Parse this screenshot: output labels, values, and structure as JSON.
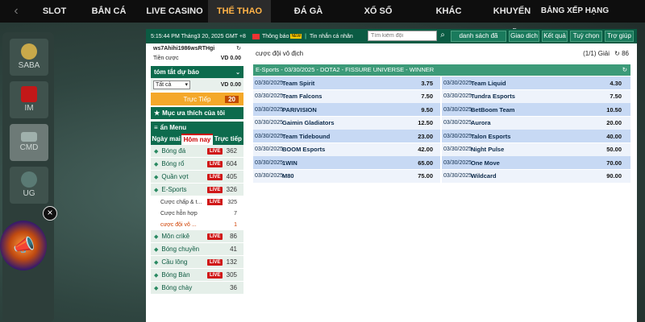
{
  "topnav": {
    "items": [
      "SLOT",
      "BẮN CÁ",
      "LIVE CASINO",
      "THỂ THAO",
      "ĐÁ GÀ",
      "XỔ SỐ",
      "KHÁC",
      "KHUYẾN MÃI",
      "BẢNG XẾP HẠNG"
    ],
    "active": 3
  },
  "providers": [
    "SABA",
    "IM",
    "CMD",
    "UG"
  ],
  "app": {
    "datetime": "5:15:44 PM Tháng3 20, 2025 GMT +8",
    "announcement": "Thông báo",
    "inbox": "Tin nhắn cá nhân",
    "inbox_badge": "NEW",
    "search_placeholder": "Tìm kiếm đội",
    "buttons": [
      "danh sách đã cược",
      "Giao dich",
      "Kết quả",
      "Tuỳ chọn",
      "Trợ giúp"
    ]
  },
  "sidebar": {
    "username": "ws7Ahihi1986wsRTHgi",
    "balance_label": "Tiền cược",
    "balance_value": "VD 0.00",
    "bet_summary": "tóm tắt dự báo",
    "bet_select": "Tất cả",
    "bet_amount": "VD 0.00",
    "live_label": "Trực Tiếp",
    "live_count": "20",
    "favorites": "Mục ưa thích của tôi",
    "menu": "ẩn Menu",
    "tabs": [
      "Ngày mai",
      "Hôm nay",
      "Trực tiếp"
    ],
    "sports": [
      {
        "name": "Bóng đá",
        "live": "LIVE",
        "count": "362"
      },
      {
        "name": "Bóng rổ",
        "live": "LIVE",
        "count": "604"
      },
      {
        "name": "Quần vợt",
        "live": "LIVE",
        "count": "405"
      },
      {
        "name": "E-Sports",
        "live": "LIVE",
        "count": "326"
      }
    ],
    "esports_sub": [
      {
        "name": "Cược chấp & t...",
        "live": "LIVE",
        "count": "325"
      },
      {
        "name": "Cược hỗn hợp",
        "live": "",
        "count": "7"
      },
      {
        "name": "cược đội vô ...",
        "live": "",
        "count": "1"
      }
    ],
    "sports2": [
      {
        "name": "Môn crikê",
        "live": "LIVE",
        "count": "86"
      },
      {
        "name": "Bóng chuyền",
        "live": "",
        "count": "41"
      },
      {
        "name": "Cầu lông",
        "live": "LIVE",
        "count": "132"
      },
      {
        "name": "Bóng Bàn",
        "live": "LIVE",
        "count": "305"
      },
      {
        "name": "Bóng chày",
        "live": "",
        "count": "36"
      }
    ]
  },
  "main": {
    "title": "cược đội vô địch",
    "pager": "(1/1) Giải",
    "refresh_count": "86",
    "league": "E-Sports - 03/30/2025 - DOTA2 - FISSURE UNIVERSE - WINNER",
    "rows": [
      [
        {
          "date": "03/30/2025",
          "team": "Team Spirit",
          "odds": "3.75"
        },
        {
          "date": "03/30/2025",
          "team": "Team Liquid",
          "odds": "4.30"
        }
      ],
      [
        {
          "date": "03/30/2025",
          "team": "Team Falcons",
          "odds": "7.50"
        },
        {
          "date": "03/30/2025",
          "team": "Tundra Esports",
          "odds": "7.50"
        }
      ],
      [
        {
          "date": "03/30/2025",
          "team": "PARIVISION",
          "odds": "9.50"
        },
        {
          "date": "03/30/2025",
          "team": "BetBoom Team",
          "odds": "10.50"
        }
      ],
      [
        {
          "date": "03/30/2025",
          "team": "Gaimin Gladiators",
          "odds": "12.50"
        },
        {
          "date": "03/30/2025",
          "team": "Aurora",
          "odds": "20.00"
        }
      ],
      [
        {
          "date": "03/30/2025",
          "team": "Team Tidebound",
          "odds": "23.00"
        },
        {
          "date": "03/30/2025",
          "team": "Talon Esports",
          "odds": "40.00"
        }
      ],
      [
        {
          "date": "03/30/2025",
          "team": "BOOM Esports",
          "odds": "42.00"
        },
        {
          "date": "03/30/2025",
          "team": "Night Pulse",
          "odds": "50.00"
        }
      ],
      [
        {
          "date": "03/30/2025",
          "team": "1WIN",
          "odds": "65.00"
        },
        {
          "date": "03/30/2025",
          "team": "One Move",
          "odds": "70.00"
        }
      ],
      [
        {
          "date": "03/30/2025",
          "team": "M80",
          "odds": "75.00"
        },
        {
          "date": "03/30/2025",
          "team": "Wildcard",
          "odds": "90.00"
        }
      ]
    ]
  },
  "colors": {
    "nav_bg": "#0e0e0e",
    "nav_active_text": "#ffb347",
    "brand_green": "#0d6b4d",
    "league_bar": "#3c9a78",
    "live_badge": "#d01818",
    "live_button": "#f4a82a"
  }
}
